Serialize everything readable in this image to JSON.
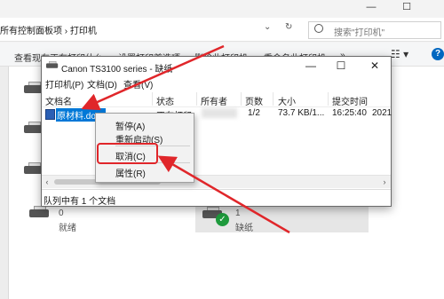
{
  "window": {
    "minimize": "—",
    "maximize": "☐"
  },
  "address": {
    "path": "所有控制面板项  ›  打印机",
    "search_placeholder": "搜索\"打印机\""
  },
  "commandbar": {
    "items": [
      "查看现在正在打印什么",
      "设置打印首选项",
      "删除此打印机",
      "重命名此打印机",
      "»"
    ],
    "view_icon": "view-options-icon"
  },
  "dialog": {
    "title": "Canon TS3100 series - 缺纸",
    "controls": {
      "minimize": "—",
      "maximize": "☐",
      "close": "✕"
    },
    "menus": [
      "打印机(P)",
      "文档(D)",
      "查看(V)"
    ],
    "columns": [
      "文档名",
      "状态",
      "所有者",
      "页数",
      "大小",
      "提交时间"
    ],
    "job": {
      "name": "原材料.docx",
      "status": "正在打印",
      "owner": "",
      "pages": "1/2",
      "size": "73.7 KB/1...",
      "time": "16:25:40",
      "date": "2021"
    },
    "status": "队列中有 1 个文档"
  },
  "context_menu": {
    "items": [
      "暂停(A)",
      "重新启动(S)",
      "取消(C)",
      "属性(R)"
    ],
    "highlighted": "取消(C)"
  },
  "printers": [
    {
      "count": "0",
      "state": "就绪"
    },
    {
      "count": "1",
      "state": "缺纸"
    }
  ],
  "colors": {
    "annotation": "#e0262a",
    "selection": "#0078d7",
    "check": "#1e9a3c"
  }
}
